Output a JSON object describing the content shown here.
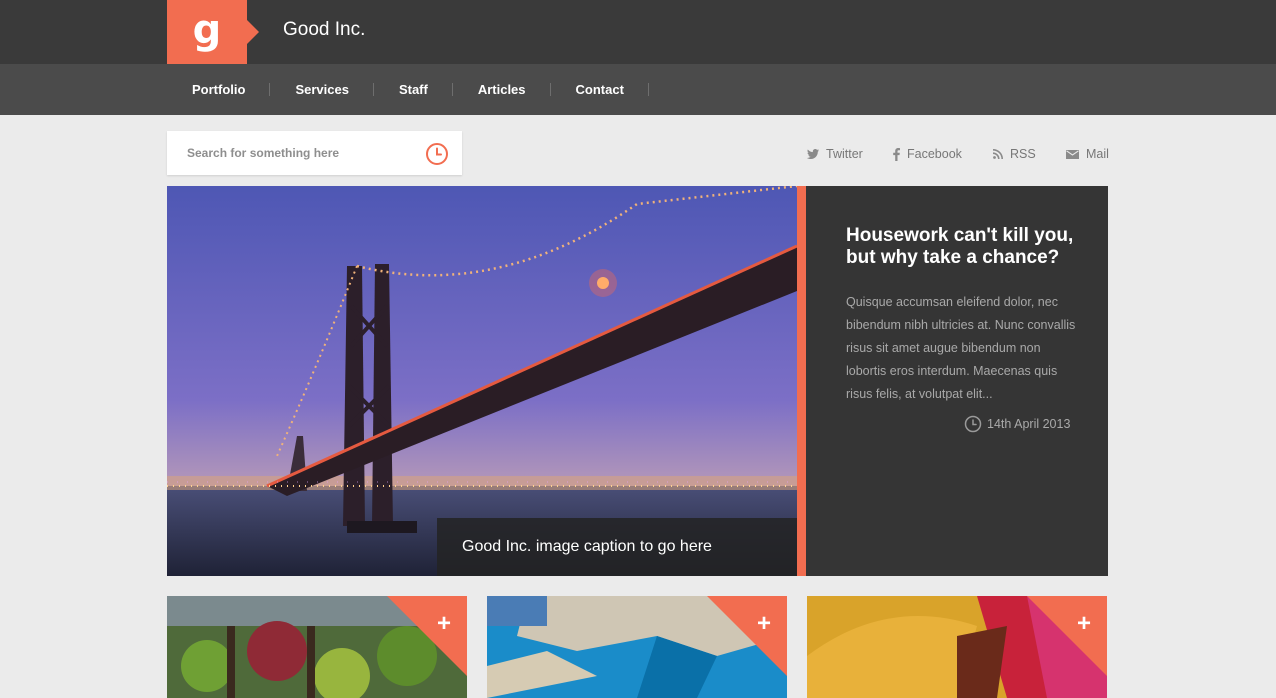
{
  "brand": {
    "logo_letter": "g",
    "name": "Good Inc."
  },
  "nav": {
    "items": [
      "Portfolio",
      "Services",
      "Staff",
      "Articles",
      "Contact"
    ]
  },
  "search": {
    "placeholder": "Search for something here",
    "icon": "clock-icon"
  },
  "social": {
    "twitter": "Twitter",
    "facebook": "Facebook",
    "rss": "RSS",
    "mail": "Mail"
  },
  "hero": {
    "title": "Housework can't kill you, but why take a chance?",
    "body": "Quisque accumsan eleifend dolor, nec bibendum nibh ultricies at. Nunc convallis risus sit amet augue bibendum non lobortis eros interdum. Maecenas quis risus felis, at volutpat elit...",
    "date": "14th April 2013",
    "caption": "Good Inc. image caption to go here"
  },
  "thumbs": {
    "plus": "+"
  },
  "colors": {
    "accent": "#f26d50",
    "topbar": "#3a3a3a",
    "navbar": "#4b4b4b",
    "panel": "#353535"
  }
}
